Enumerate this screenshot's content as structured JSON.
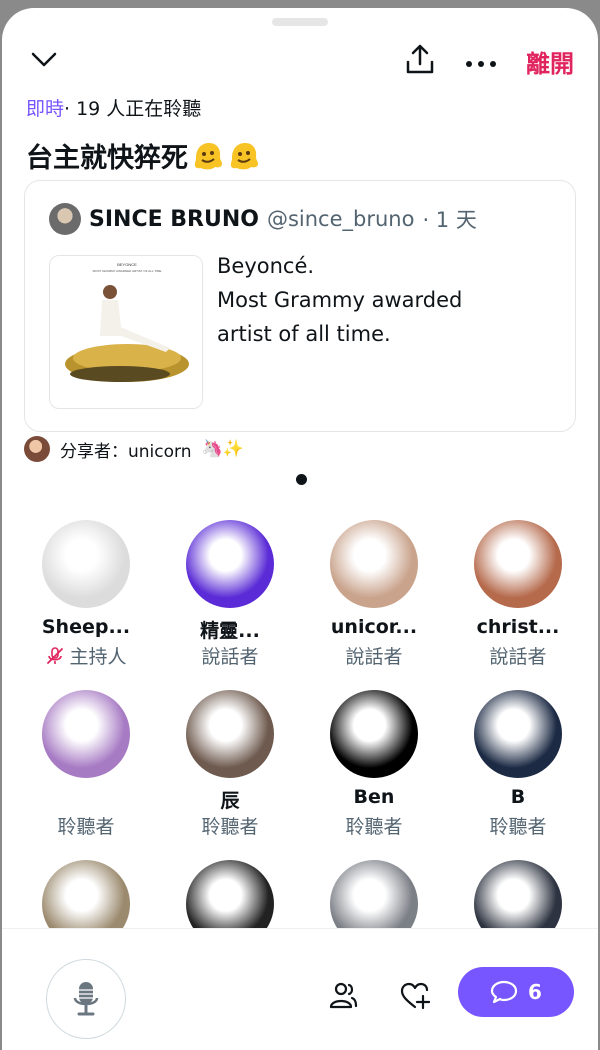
{
  "header": {
    "leave_label": "離開"
  },
  "space": {
    "live_label": "即時",
    "listeners_text": "· 19 人正在聆聽",
    "title": "台主就快猝死"
  },
  "pinned_post": {
    "author_name": "SINCE BRUNO",
    "author_handle": "@since_bruno",
    "time": "· 1 天",
    "body_lines": [
      "Beyoncé.",
      "Most Grammy awarded",
      "artist of all time."
    ],
    "thumb_caption_1": "BEYONCE",
    "thumb_caption_2": "MOST GRAMMY AWARDED ARTIST OF ALL TIME"
  },
  "sharer": {
    "text": "分享者：unicorn",
    "emoji": "🦄✨"
  },
  "participants": [
    {
      "name": "Sheep...",
      "role": "主持人",
      "muted": true,
      "color": "#dcdcdc"
    },
    {
      "name": "精靈...",
      "role": "說話者",
      "muted": false,
      "color": "#5a2bd6"
    },
    {
      "name": "unicor...",
      "role": "說話者",
      "muted": false,
      "color": "#c9a38c"
    },
    {
      "name": "christ...",
      "role": "說話者",
      "muted": false,
      "color": "#b56a4c"
    },
    {
      "name": "",
      "role": "聆聽者",
      "muted": false,
      "color": "#a77bc4"
    },
    {
      "name": "辰",
      "role": "聆聽者",
      "muted": false,
      "color": "#6e5a4e"
    },
    {
      "name": "Ben",
      "role": "聆聽者",
      "muted": false,
      "color": "#000000"
    },
    {
      "name": "B",
      "role": "聆聽者",
      "muted": false,
      "color": "#1c2a44"
    },
    {
      "name": "",
      "role": "",
      "muted": false,
      "color": "#9b8a6e"
    },
    {
      "name": "",
      "role": "",
      "muted": false,
      "color": "#222222"
    },
    {
      "name": "",
      "role": "",
      "muted": false,
      "color": "#7b7f86"
    },
    {
      "name": "",
      "role": "",
      "muted": false,
      "color": "#2d3340"
    }
  ],
  "bottom_bar": {
    "chat_count": "6"
  },
  "colors": {
    "accent": "#7856ff",
    "leave": "#e0245e"
  }
}
